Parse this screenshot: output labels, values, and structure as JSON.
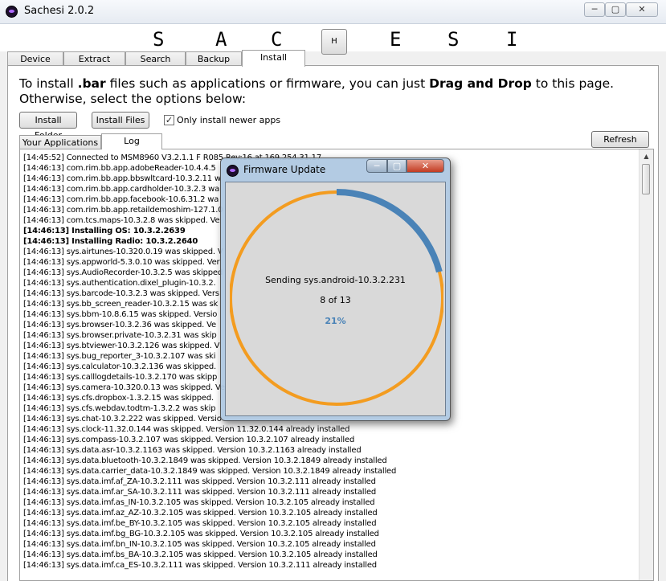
{
  "window": {
    "title": "Sachesi 2.0.2",
    "icon": "sachesi-app-icon",
    "controls": [
      "─",
      "▢",
      "✕"
    ]
  },
  "header": {
    "letters": [
      "S",
      "A",
      "C",
      "E",
      "S",
      "I"
    ],
    "h_button": "H"
  },
  "tabs": [
    {
      "label": "Device",
      "active": false
    },
    {
      "label": "Extract",
      "active": false
    },
    {
      "label": "Search",
      "active": false
    },
    {
      "label": "Backup",
      "active": false
    },
    {
      "label": "Install",
      "active": true
    }
  ],
  "install": {
    "instr_1": "To install ",
    "instr_2": ".bar",
    "instr_3": " files such as applications or firmware, you can just ",
    "instr_4": "Drag and Drop",
    "instr_5": " to this page. Otherwise, select the options below:",
    "install_folder": "Install Folder",
    "install_files": "Install Files",
    "only_newer_label": "Only install newer apps",
    "only_newer_checked": "✓",
    "refresh": "Refresh",
    "subtabs": [
      {
        "label": "Your Applications",
        "active": false
      },
      {
        "label": "Log",
        "active": true
      }
    ]
  },
  "log": [
    {
      "text": "[14:45:52] Connected to MSM8960 V3.2.1.1 F R085 Rev:16 at 169.254.31.17",
      "bold": false
    },
    {
      "text": "[14:46:13] com.rim.bb.app.adobeReader-10.4.4.5",
      "bold": false
    },
    {
      "text": "[14:46:13] com.rim.bb.app.bbswltcard-10.3.2.11 w",
      "bold": false
    },
    {
      "text": "[14:46:13] com.rim.bb.app.cardholder-10.3.2.3 wa",
      "bold": false
    },
    {
      "text": "[14:46:13] com.rim.bb.app.facebook-10.6.31.2 wa",
      "bold": false
    },
    {
      "text": "[14:46:13] com.rim.bb.app.retaildemoshim-127.1.0",
      "bold": false
    },
    {
      "text": "[14:46:13] com.tcs.maps-10.3.2.8 was skipped. Ve",
      "bold": false
    },
    {
      "text": "[14:46:13] Installing OS: 10.3.2.2639",
      "bold": true
    },
    {
      "text": "[14:46:13] Installing Radio: 10.3.2.2640",
      "bold": true
    },
    {
      "text": "[14:46:13] sys.airtunes-10.320.0.19 was skipped. V",
      "bold": false
    },
    {
      "text": "[14:46:13] sys.appworld-5.3.0.10 was skipped. Ver",
      "bold": false
    },
    {
      "text": "[14:46:13] sys.AudioRecorder-10.3.2.5 was skipped",
      "bold": false
    },
    {
      "text": "[14:46:13] sys.authentication.dixel_plugin-10.3.2.",
      "bold": false
    },
    {
      "text": "[14:46:13] sys.barcode-10.3.2.3 was skipped. Vers",
      "bold": false
    },
    {
      "text": "[14:46:13] sys.bb_screen_reader-10.3.2.15 was sk",
      "bold": false
    },
    {
      "text": "[14:46:13] sys.bbm-10.8.6.15 was skipped. Versio",
      "bold": false
    },
    {
      "text": "[14:46:13] sys.browser-10.3.2.36 was skipped. Ve",
      "bold": false
    },
    {
      "text": "[14:46:13] sys.browser.private-10.3.2.31 was skip",
      "bold": false
    },
    {
      "text": "[14:46:13] sys.btviewer-10.3.2.126 was skipped. V",
      "bold": false
    },
    {
      "text": "[14:46:13] sys.bug_reporter_3-10.3.2.107 was ski",
      "bold": false
    },
    {
      "text": "[14:46:13] sys.calculator-10.3.2.136 was skipped.",
      "bold": false
    },
    {
      "text": "[14:46:13] sys.calllogdetails-10.3.2.170 was skipp",
      "bold": false
    },
    {
      "text": "[14:46:13] sys.camera-10.320.0.13 was skipped. Ve",
      "bold": false
    },
    {
      "text": "[14:46:13] sys.cfs.dropbox-1.3.2.15 was skipped.",
      "bold": false
    },
    {
      "text": "[14:46:13] sys.cfs.webdav.todtm-1.3.2.2 was skip",
      "bold": false
    },
    {
      "text": "[14:46:13] sys.chat-10.3.2.222 was skipped. Versio",
      "bold": false
    },
    {
      "text": "[14:46:13] sys.clock-11.32.0.144 was skipped. Version 11.32.0.144 already installed",
      "bold": false
    },
    {
      "text": "[14:46:13] sys.compass-10.3.2.107 was skipped. Version 10.3.2.107 already installed",
      "bold": false
    },
    {
      "text": "[14:46:13] sys.data.asr-10.3.2.1163 was skipped. Version 10.3.2.1163 already installed",
      "bold": false
    },
    {
      "text": "[14:46:13] sys.data.bluetooth-10.3.2.1849 was skipped. Version 10.3.2.1849 already installed",
      "bold": false
    },
    {
      "text": "[14:46:13] sys.data.carrier_data-10.3.2.1849 was skipped. Version 10.3.2.1849 already installed",
      "bold": false
    },
    {
      "text": "[14:46:13] sys.data.imf.af_ZA-10.3.2.111 was skipped. Version 10.3.2.111 already installed",
      "bold": false
    },
    {
      "text": "[14:46:13] sys.data.imf.ar_SA-10.3.2.111 was skipped. Version 10.3.2.111 already installed",
      "bold": false
    },
    {
      "text": "[14:46:13] sys.data.imf.as_IN-10.3.2.105 was skipped. Version 10.3.2.105 already installed",
      "bold": false
    },
    {
      "text": "[14:46:13] sys.data.imf.az_AZ-10.3.2.105 was skipped. Version 10.3.2.105 already installed",
      "bold": false
    },
    {
      "text": "[14:46:13] sys.data.imf.be_BY-10.3.2.105 was skipped. Version 10.3.2.105 already installed",
      "bold": false
    },
    {
      "text": "[14:46:13] sys.data.imf.bg_BG-10.3.2.105 was skipped. Version 10.3.2.105 already installed",
      "bold": false
    },
    {
      "text": "[14:46:13] sys.data.imf.bn_IN-10.3.2.105 was skipped. Version 10.3.2.105 already installed",
      "bold": false
    },
    {
      "text": "[14:46:13] sys.data.imf.bs_BA-10.3.2.105 was skipped. Version 10.3.2.105 already installed",
      "bold": false
    },
    {
      "text": "[14:46:13] sys.data.imf.ca_ES-10.3.2.111 was skipped. Version 10.3.2.111 already installed",
      "bold": false
    }
  ],
  "dialog": {
    "title": "Firmware Update",
    "sending_text": "Sending sys.android-10.3.2.231",
    "count_text": "8 of 13",
    "percent_text": "21%",
    "progress_fraction": 0.21,
    "ring_track_color": "#f39c20",
    "ring_progress_color": "#4a83b7"
  }
}
